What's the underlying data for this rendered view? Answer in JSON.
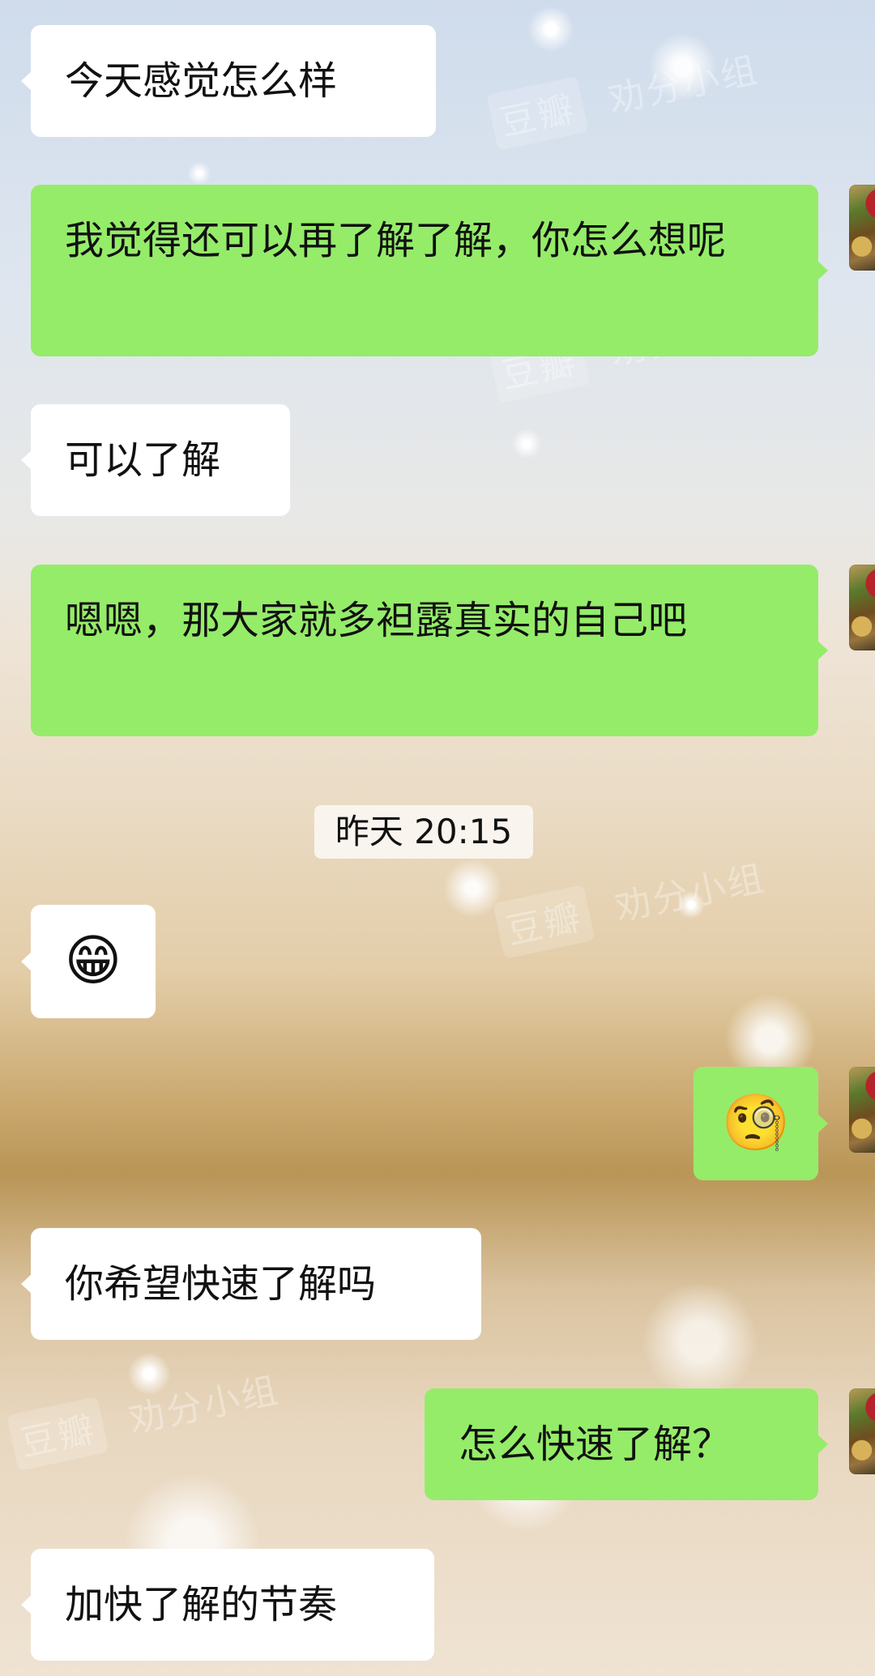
{
  "watermark": {
    "badge": "豆瓣",
    "text": "劝分小组"
  },
  "messages": [
    {
      "id": "m1",
      "side": "left",
      "text": "今天感觉怎么样"
    },
    {
      "id": "m2",
      "side": "right",
      "text": "我觉得还可以再了解了解，你怎么想呢"
    },
    {
      "id": "m3",
      "side": "left",
      "text": "可以了解"
    },
    {
      "id": "m4",
      "side": "right",
      "text": "嗯嗯，那大家就多袒露真实的自己吧"
    },
    {
      "id": "m5",
      "side": "left",
      "emoji": "😁"
    },
    {
      "id": "m6",
      "side": "right",
      "emoji": "🧐"
    },
    {
      "id": "m7",
      "side": "left",
      "text": "你希望快速了解吗"
    },
    {
      "id": "m8",
      "side": "right",
      "text": "怎么快速了解？"
    },
    {
      "id": "m9",
      "side": "left",
      "text": "加快了解的节奏"
    }
  ],
  "timestamp": "昨天 20:15"
}
